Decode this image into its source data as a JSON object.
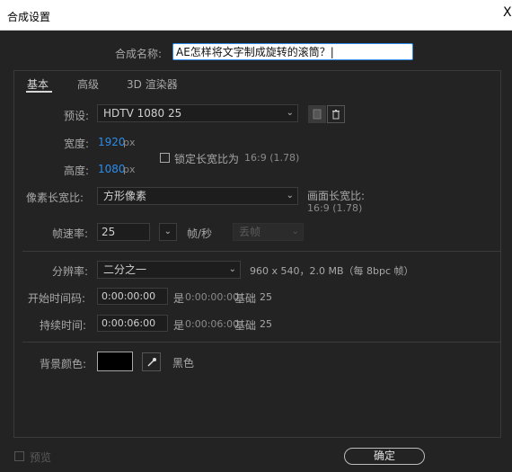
{
  "window": {
    "title": "合成设置",
    "close_glyph": "X"
  },
  "comp_name": {
    "label": "合成名称:",
    "value": "AE怎样将文字制成旋转的滚筒？|"
  },
  "tabs": [
    {
      "label": "基本",
      "active": true
    },
    {
      "label": "高级",
      "active": false
    },
    {
      "label": "3D 渲染器",
      "active": false
    }
  ],
  "preset": {
    "label": "预设:",
    "value": "HDTV 1080 25"
  },
  "width": {
    "label": "宽度:",
    "value": "1920",
    "unit": "px"
  },
  "height": {
    "label": "高度:",
    "value": "1080",
    "unit": "px"
  },
  "lock_aspect": {
    "label": "锁定长宽比为",
    "ratio": "16:9 (1.78)",
    "checked": false
  },
  "pixel_aspect": {
    "label": "像素长宽比:",
    "value": "方形像素"
  },
  "frame_aspect": {
    "label": "画面长宽比:",
    "value": "16:9 (1.78)"
  },
  "frame_rate": {
    "label": "帧速率:",
    "value": "25",
    "unit": "帧/秒",
    "drop_frame": "丢帧"
  },
  "resolution": {
    "label": "分辨率:",
    "value": "二分之一",
    "info": "960 x 540，2.0 MB（每 8bpc 帧）"
  },
  "start_timecode": {
    "label": "开始时间码:",
    "value": "0:00:00:00",
    "is_label": "是",
    "is_value": "0:00:00:00",
    "base_label": "基础",
    "base_value": "25"
  },
  "duration": {
    "label": "持续时间:",
    "value": "0:00:06:00",
    "is_label": "是",
    "is_value": "0:00:06:00",
    "base_label": "基础",
    "base_value": "25"
  },
  "background": {
    "label": "背景颜色:",
    "color": "#000000",
    "color_name": "黑色"
  },
  "preview": {
    "label": "预览",
    "checked": false
  },
  "ok_button": {
    "label": "确定"
  },
  "accent_color": "#2d8ceb"
}
